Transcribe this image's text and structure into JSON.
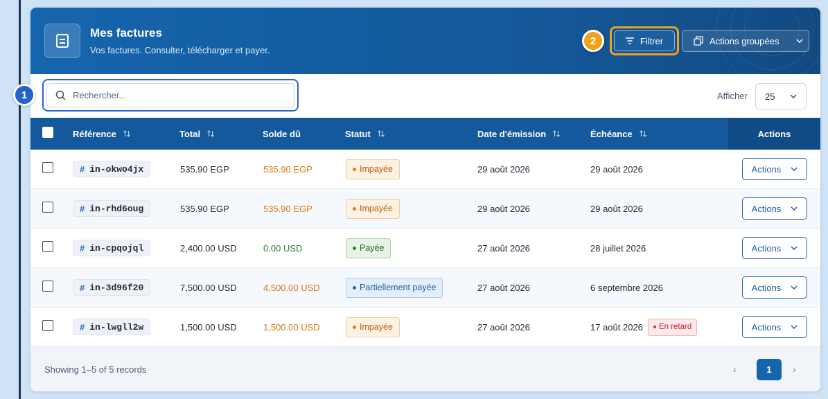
{
  "header": {
    "title": "Mes factures",
    "subtitle": "Vos factures. Consulter, télécharger et payer.",
    "filter_label": "Filtrer",
    "bulk_actions_label": "Actions groupées"
  },
  "markers": {
    "one": "1",
    "two": "2"
  },
  "search": {
    "placeholder": "Rechercher..."
  },
  "page_size": {
    "label": "Afficher",
    "value": "25"
  },
  "table": {
    "columns": {
      "reference": "Référence",
      "total": "Total",
      "balance_due": "Solde dû",
      "status": "Statut",
      "issue_date": "Date d'émission",
      "due_date": "Échéance",
      "actions": "Actions"
    },
    "rows": [
      {
        "ref": "in-okwo4jx",
        "total": "535.90 EGP",
        "due": "535.90 EGP",
        "status": "Impayée",
        "issued": "29 août 2026",
        "deadline": "29 août 2026",
        "overdue": "",
        "action": "Actions"
      },
      {
        "ref": "in-rhd6oug",
        "total": "535.90 EGP",
        "due": "535.90 EGP",
        "status": "Impayée",
        "issued": "29 août 2026",
        "deadline": "29 août 2026",
        "overdue": "",
        "action": "Actions"
      },
      {
        "ref": "in-cpqojql",
        "total": "2,400.00 USD",
        "due": "0.00 USD",
        "status": "Payée",
        "issued": "27 août 2026",
        "deadline": "28 juillet 2026",
        "overdue": "",
        "action": "Actions"
      },
      {
        "ref": "in-3d96f20",
        "total": "7,500.00 USD",
        "due": "4,500.00 USD",
        "status": "Partiellement payée",
        "issued": "27 août 2026",
        "deadline": "6 septembre 2026",
        "overdue": "",
        "action": "Actions"
      },
      {
        "ref": "in-lwgll2w",
        "total": "1,500.00 USD",
        "due": "1,500.00 USD",
        "status": "Impayée",
        "issued": "27 août 2026",
        "deadline": "17 août 2026",
        "overdue": "En retard",
        "action": "Actions"
      }
    ]
  },
  "footer": {
    "records": "Showing 1–5 of 5 records",
    "current_page": "1"
  },
  "icons": {
    "header": "invoice-icon",
    "filter": "filter-lines-icon",
    "bulk": "copy-stack-icon",
    "search": "search-icon",
    "sort": "sort-arrows-icon",
    "chevron": "chevron-down-icon"
  },
  "colors": {
    "header_blue": "#1565ae",
    "accent_orange": "#f0a21b",
    "highlight_blue": "#2f62d6",
    "unpaid": "#e07b0e",
    "paid": "#2e7d32",
    "overdue": "#c0212e"
  }
}
